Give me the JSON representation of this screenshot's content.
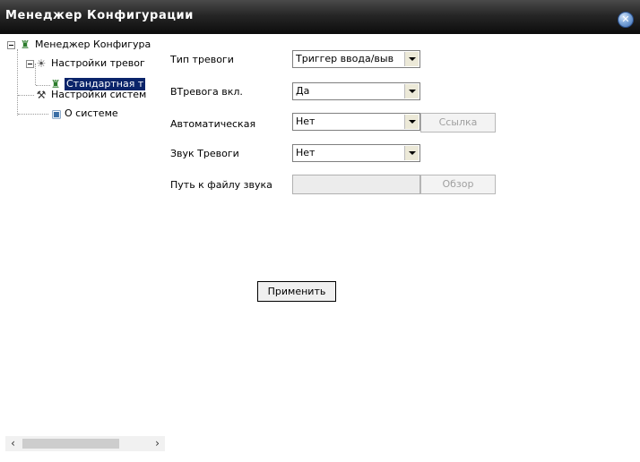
{
  "window": {
    "title": "Менеджер Конфигурации"
  },
  "tree": {
    "root": "Менеджер Конфигура",
    "alarm_settings": "Настройки тревог",
    "standard_alarm": "Стандартная т",
    "system_settings": "Настройки систем",
    "about": "О системе"
  },
  "form": {
    "alarm_type_label": "Тип тревоги",
    "alarm_type_value": "Триггер ввода/выв",
    "alarm_on_label": "ВТревога вкл.",
    "alarm_on_value": "Да",
    "auto_label": "Автоматическая",
    "auto_value": "Нет",
    "link_button": "Ссылка",
    "sound_label": "Звук Тревоги",
    "sound_value": "Нет",
    "sound_path_label": "Путь к файлу звука",
    "sound_path_value": "",
    "browse_button": "Обзор",
    "apply_button": "Применить"
  },
  "colors": {
    "titlebar": "#1a1a1a",
    "selection": "#0a246a",
    "close_button": "#5b8fd1"
  }
}
